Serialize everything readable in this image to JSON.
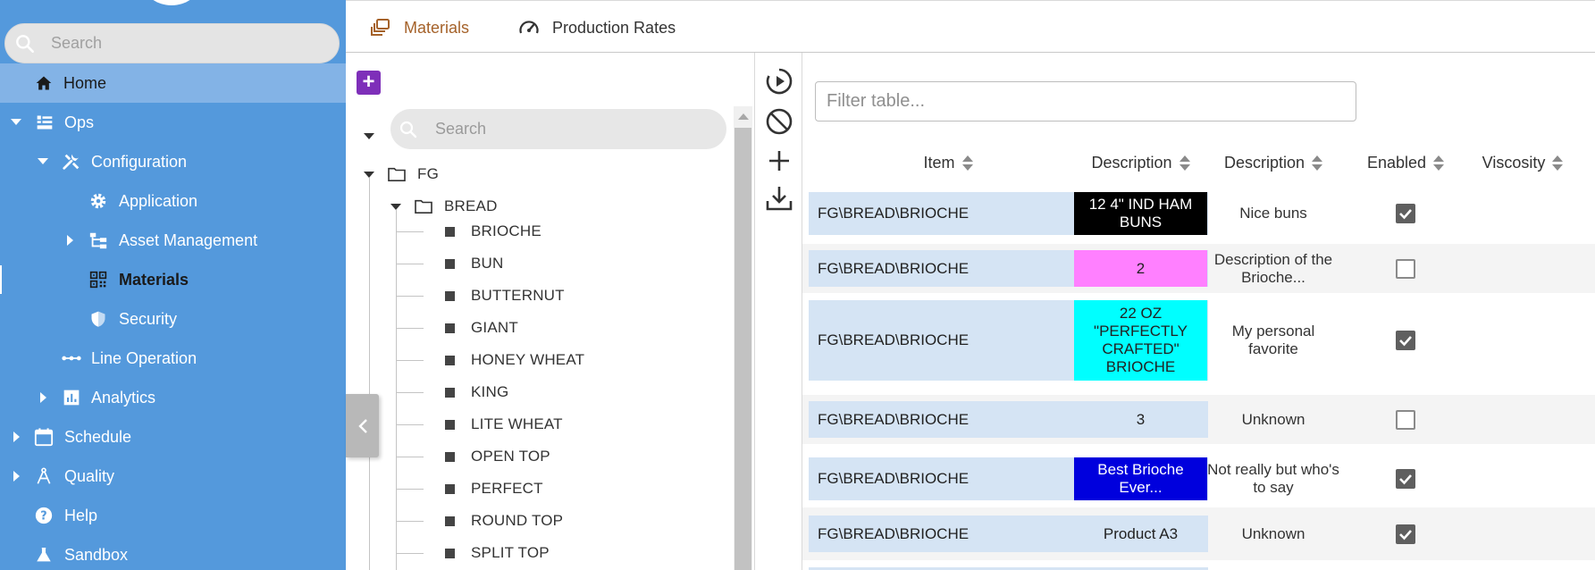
{
  "sidebar": {
    "search_placeholder": "Search",
    "items": [
      {
        "label": "Home"
      },
      {
        "label": "Ops"
      },
      {
        "label": "Configuration"
      },
      {
        "label": "Application"
      },
      {
        "label": "Asset Management"
      },
      {
        "label": "Materials"
      },
      {
        "label": "Security"
      },
      {
        "label": "Line Operation"
      },
      {
        "label": "Analytics"
      },
      {
        "label": "Schedule"
      },
      {
        "label": "Quality"
      },
      {
        "label": "Help"
      },
      {
        "label": "Sandbox"
      }
    ]
  },
  "tabs": [
    {
      "label": "Materials",
      "icon": "stacked-layers-icon",
      "active": true
    },
    {
      "label": "Production Rates",
      "icon": "speedometer-icon",
      "active": false
    }
  ],
  "tree": {
    "search_placeholder": "Search",
    "root": "FG",
    "group": "BREAD",
    "leaves": [
      "BRIOCHE",
      "BUN",
      "BUTTERNUT",
      "GIANT",
      "HONEY WHEAT",
      "KING",
      "LITE WHEAT",
      "OPEN TOP",
      "PERFECT",
      "ROUND TOP",
      "SPLIT TOP"
    ]
  },
  "table": {
    "filter_placeholder": "Filter table...",
    "columns": [
      "Item",
      "Description",
      "Description",
      "Enabled",
      "Viscosity"
    ],
    "rows": [
      {
        "item": "FG\\BREAD\\BRIOCHE",
        "desc": "12 4\" IND HAM BUNS",
        "desc_bg": "#000000",
        "desc_fg": "#ffffff",
        "desc2": "Nice buns",
        "enabled": true
      },
      {
        "item": "FG\\BREAD\\BRIOCHE",
        "desc": "2",
        "desc_bg": "#ff80ff",
        "desc_fg": "#222222",
        "desc2": "Description of the Brioche...",
        "enabled": false
      },
      {
        "item": "FG\\BREAD\\BRIOCHE",
        "desc": "22 OZ \"PERFECTLY CRAFTED\" BRIOCHE",
        "desc_bg": "#00ffff",
        "desc_fg": "#222222",
        "desc2": "My personal favorite",
        "enabled": true
      },
      {
        "item": "FG\\BREAD\\BRIOCHE",
        "desc": "3",
        "desc_bg": "#d5e4f4",
        "desc_fg": "#222222",
        "desc2": "Unknown",
        "enabled": false
      },
      {
        "item": "FG\\BREAD\\BRIOCHE",
        "desc": "Best Brioche Ever...",
        "desc_bg": "#0000dd",
        "desc_fg": "#ffffff",
        "desc2": "Not really but who's to say",
        "enabled": true
      },
      {
        "item": "FG\\BREAD\\BRIOCHE",
        "desc": "Product A3",
        "desc_bg": "#d5e4f4",
        "desc_fg": "#222222",
        "desc2": "Unknown",
        "enabled": true
      }
    ]
  },
  "colors": {
    "sidebar_bg": "#5499dc",
    "sidebar_active": "#83b3e6",
    "tab_active": "#a5622a",
    "add_button": "#7e2fb9"
  }
}
